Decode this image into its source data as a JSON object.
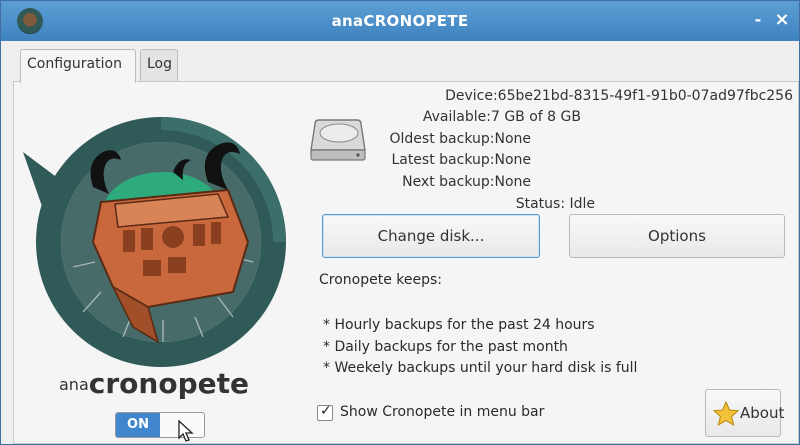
{
  "window": {
    "title": "anaCRONOPETE",
    "minimize_label": "-",
    "close_label": "×"
  },
  "tabs": [
    {
      "label": "Configuration",
      "active": true
    },
    {
      "label": "Log",
      "active": false
    }
  ],
  "brand": {
    "prefix": "ana",
    "name": "cronopete"
  },
  "toggle": {
    "label": "ON",
    "state": "on"
  },
  "disk": {
    "device": "Device:65be21bd-8315-49f1-91b0-07ad97fbc256",
    "available": "Available:7 GB of 8 GB",
    "oldest": "Oldest backup:None",
    "latest": "Latest backup:None",
    "next": "Next backup:None",
    "status": "Status: Idle"
  },
  "buttons": {
    "change_disk": "Change disk...",
    "options": "Options",
    "about": "About"
  },
  "keeps": {
    "heading": "Cronopete keeps:",
    "items": [
      "* Hourly backups for the past 24 hours",
      "* Daily backups for the past month",
      "* Weekely backups until your hard disk is full"
    ]
  },
  "menu_bar": {
    "label": "Show Cronopete in menu bar",
    "checked": true
  },
  "colors": {
    "titlebar": "#4a8fcb",
    "accent": "#3f86cf",
    "logo_teal": "#2f5a57",
    "logo_brown": "#c9683c"
  },
  "icons": [
    "app-icon",
    "hard-disk-icon",
    "star-icon",
    "mouse-cursor-icon",
    "checkmark-icon"
  ]
}
